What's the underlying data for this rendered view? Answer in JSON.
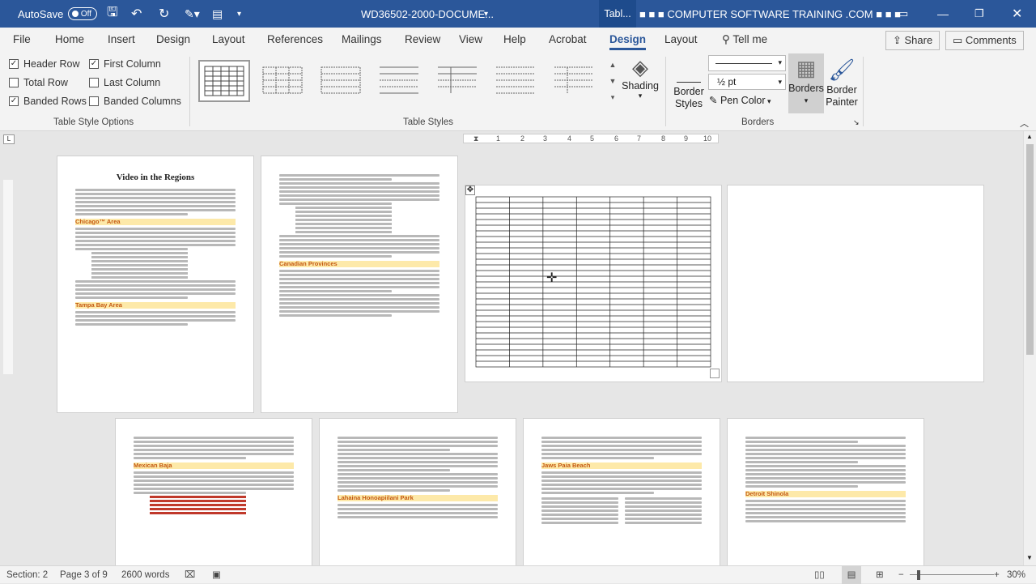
{
  "titlebar": {
    "autosave_label": "AutoSave",
    "autosave_state": "Off",
    "doc_title": "WD36502-2000-DOCUME...",
    "context_tab": "Tabl...",
    "brand": "■ ■ ■ COMPUTER SOFTWARE TRAINING .COM ■ ■ ■"
  },
  "tabs": [
    "File",
    "Home",
    "Insert",
    "Design",
    "Layout",
    "References",
    "Mailings",
    "Review",
    "View",
    "Help",
    "Acrobat",
    "Design",
    "Layout"
  ],
  "active_tab": "Design",
  "tell_me": "Tell me",
  "share": "Share",
  "comments": "Comments",
  "table_style_options": {
    "group_label": "Table Style Options",
    "options": [
      {
        "label": "Header Row",
        "checked": true
      },
      {
        "label": "First Column",
        "checked": true
      },
      {
        "label": "Total Row",
        "checked": false
      },
      {
        "label": "Last Column",
        "checked": false
      },
      {
        "label": "Banded Rows",
        "checked": true
      },
      {
        "label": "Banded Columns",
        "checked": false
      }
    ]
  },
  "table_styles": {
    "group_label": "Table Styles",
    "shading": "Shading"
  },
  "borders": {
    "group_label": "Borders",
    "border_styles": "Border Styles",
    "weight": "½ pt",
    "pen_color": "Pen Color",
    "borders_btn": "Borders",
    "border_painter": "Border Painter"
  },
  "ruler_numbers": [
    "1",
    "2",
    "3",
    "4",
    "5",
    "6",
    "7",
    "8",
    "9",
    "10"
  ],
  "pages": {
    "p1_title": "Video in the Regions",
    "h_chicago": "Chicago™ Area",
    "h_tampa": "Tampa Bay Area",
    "h_canadian": "Canadian Provinces",
    "h_mexican": "Mexican Baja",
    "h_lahaina": "Lahaina Honoapiilani Park",
    "h_jaws": "Jaws Paia Beach",
    "h_detroit": "Detroit Shinola"
  },
  "status": {
    "section": "Section: 2",
    "page": "Page 3 of 9",
    "words": "2600 words",
    "zoom": "30%"
  },
  "colors": {
    "brand": "#2b579a",
    "heading_fill": "#fde9a9",
    "heading_text": "#c45911"
  }
}
